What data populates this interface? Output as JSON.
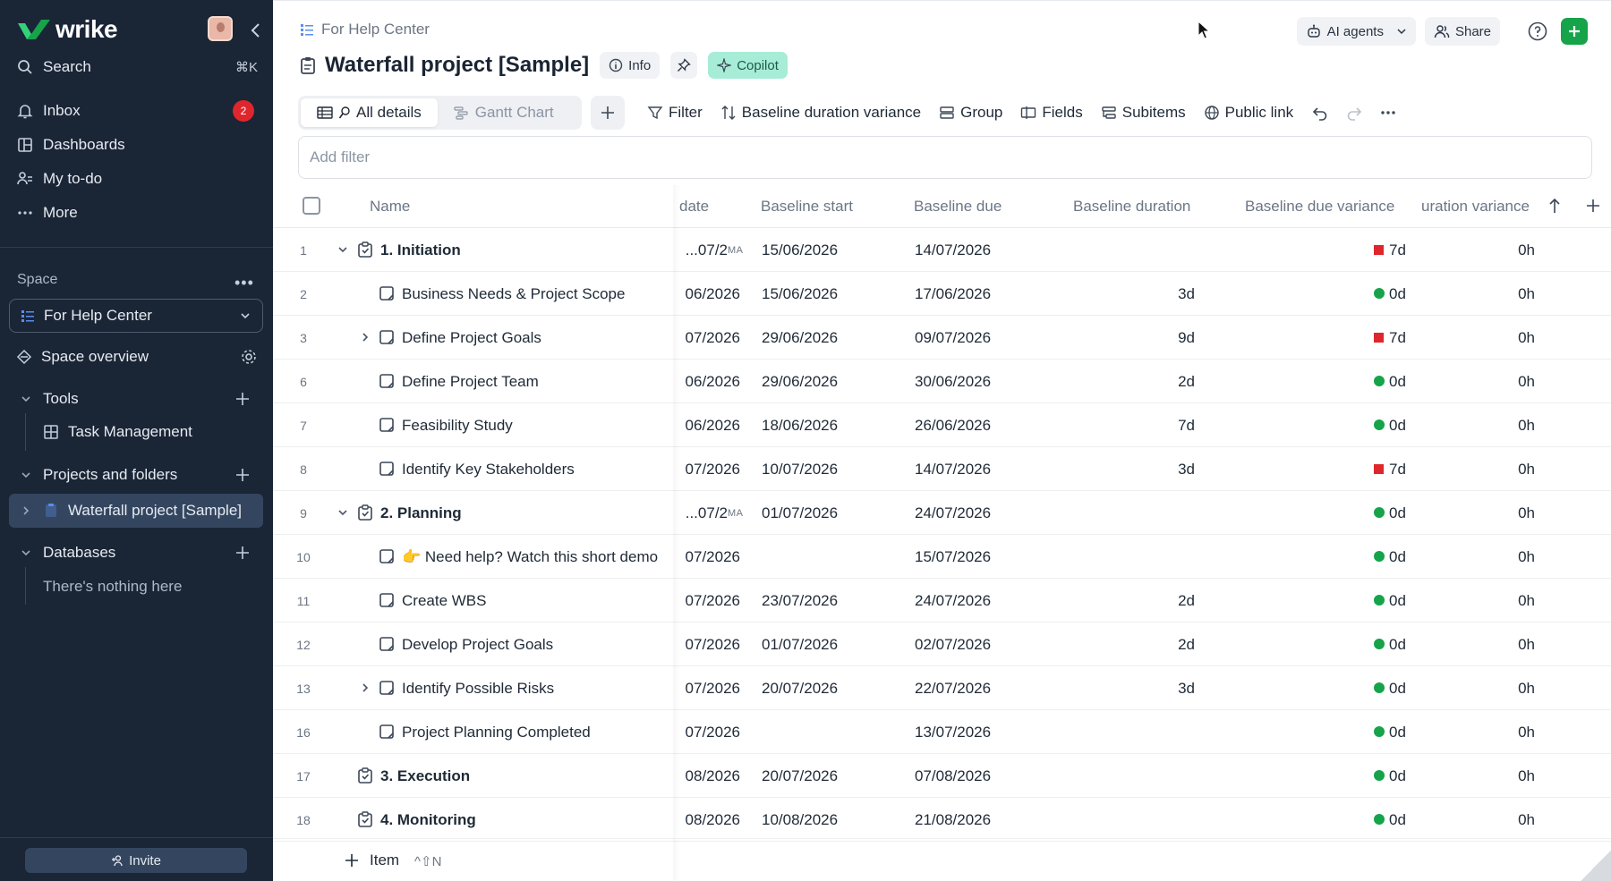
{
  "sidebar": {
    "brand": "wrike",
    "nav": [
      {
        "label": "Search",
        "icon": "search-icon",
        "shortcut": "⌘K"
      },
      {
        "label": "Inbox",
        "icon": "bell-icon",
        "badge": "2"
      },
      {
        "label": "Dashboards",
        "icon": "dashboard-icon"
      },
      {
        "label": "My to-do",
        "icon": "person-list-icon"
      },
      {
        "label": "More",
        "icon": "ellipsis-icon"
      }
    ],
    "space_label": "Space",
    "space_selected": "For Help Center",
    "space_overview": "Space overview",
    "tools_label": "Tools",
    "tools_item": "Task Management",
    "projects_label": "Projects and folders",
    "project_item": "Waterfall project [Sample]",
    "databases_label": "Databases",
    "databases_empty": "There's nothing here",
    "invite": "Invite"
  },
  "header": {
    "breadcrumb": "For Help Center",
    "title": "Waterfall project [Sample]",
    "info": "Info",
    "copilot": "Copilot",
    "ai_agents": "AI agents",
    "share": "Share"
  },
  "views": {
    "tabs": [
      "All details",
      "Gantt Chart"
    ],
    "active": "All details"
  },
  "toolbar": {
    "filter": "Filter",
    "sort": "Baseline duration variance",
    "group": "Group",
    "fields": "Fields",
    "subitems": "Subitems",
    "public_link": "Public link"
  },
  "filter_placeholder": "Add filter",
  "columns": {
    "name": "Name",
    "date": "date",
    "baseline_start": "Baseline start",
    "baseline_due": "Baseline due",
    "baseline_duration": "Baseline duration",
    "baseline_due_variance": "Baseline due variance",
    "duration_variance": "uration variance"
  },
  "rows": [
    {
      "num": "1",
      "name": "1. Initiation",
      "level": 0,
      "type": "project",
      "expander": "down",
      "date": "07/2...",
      "ma": "MA",
      "bstart": "15/06/2026",
      "bdue": "14/07/2026",
      "bdur": "",
      "status": "red",
      "dvar": "7d",
      "durvar": "0h"
    },
    {
      "num": "2",
      "name": "Business Needs & Project Scope",
      "level": 1,
      "type": "task",
      "expander": "",
      "date": "06/2026",
      "bstart": "15/06/2026",
      "bdue": "17/06/2026",
      "bdur": "3d",
      "status": "green",
      "dvar": "0d",
      "durvar": "0h"
    },
    {
      "num": "3",
      "name": "Define Project Goals",
      "level": 1,
      "type": "task",
      "expander": "right",
      "date": "07/2026",
      "bstart": "29/06/2026",
      "bdue": "09/07/2026",
      "bdur": "9d",
      "status": "red",
      "dvar": "7d",
      "durvar": "0h"
    },
    {
      "num": "6",
      "name": "Define Project Team",
      "level": 1,
      "type": "task",
      "expander": "",
      "date": "06/2026",
      "bstart": "29/06/2026",
      "bdue": "30/06/2026",
      "bdur": "2d",
      "status": "green",
      "dvar": "0d",
      "durvar": "0h"
    },
    {
      "num": "7",
      "name": "Feasibility Study",
      "level": 1,
      "type": "task",
      "expander": "",
      "date": "06/2026",
      "bstart": "18/06/2026",
      "bdue": "26/06/2026",
      "bdur": "7d",
      "status": "green",
      "dvar": "0d",
      "durvar": "0h"
    },
    {
      "num": "8",
      "name": "Identify Key Stakeholders",
      "level": 1,
      "type": "task",
      "expander": "",
      "date": "07/2026",
      "bstart": "10/07/2026",
      "bdue": "14/07/2026",
      "bdur": "3d",
      "status": "red",
      "dvar": "7d",
      "durvar": "0h"
    },
    {
      "num": "9",
      "name": "2. Planning",
      "level": 0,
      "type": "project",
      "expander": "down",
      "date": "07/2...",
      "ma": "MA",
      "bstart": "01/07/2026",
      "bdue": "24/07/2026",
      "bdur": "",
      "status": "green",
      "dvar": "0d",
      "durvar": "0h"
    },
    {
      "num": "10",
      "name": "👉 Need help? Watch this short demo",
      "level": 1,
      "type": "task",
      "expander": "",
      "date": "07/2026",
      "bstart": "",
      "bdue": "15/07/2026",
      "bdur": "",
      "status": "green",
      "dvar": "0d",
      "durvar": "0h"
    },
    {
      "num": "11",
      "name": "Create WBS",
      "level": 1,
      "type": "task",
      "expander": "",
      "date": "07/2026",
      "bstart": "23/07/2026",
      "bdue": "24/07/2026",
      "bdur": "2d",
      "status": "green",
      "dvar": "0d",
      "durvar": "0h"
    },
    {
      "num": "12",
      "name": "Develop Project Goals",
      "level": 1,
      "type": "task",
      "expander": "",
      "date": "07/2026",
      "bstart": "01/07/2026",
      "bdue": "02/07/2026",
      "bdur": "2d",
      "status": "green",
      "dvar": "0d",
      "durvar": "0h"
    },
    {
      "num": "13",
      "name": "Identify Possible Risks",
      "level": 1,
      "type": "task",
      "expander": "right",
      "date": "07/2026",
      "bstart": "20/07/2026",
      "bdue": "22/07/2026",
      "bdur": "3d",
      "status": "green",
      "dvar": "0d",
      "durvar": "0h"
    },
    {
      "num": "16",
      "name": "Project Planning Completed",
      "level": 1,
      "type": "task",
      "expander": "",
      "date": "07/2026",
      "bstart": "",
      "bdue": "13/07/2026",
      "bdur": "",
      "status": "green",
      "dvar": "0d",
      "durvar": "0h"
    },
    {
      "num": "17",
      "name": "3. Execution",
      "level": 0,
      "type": "project",
      "expander": "",
      "date": "08/2026",
      "bstart": "20/07/2026",
      "bdue": "07/08/2026",
      "bdur": "",
      "status": "green",
      "dvar": "0d",
      "durvar": "0h"
    },
    {
      "num": "18",
      "name": "4. Monitoring",
      "level": 0,
      "type": "project",
      "expander": "",
      "date": "08/2026",
      "bstart": "10/08/2026",
      "bdue": "21/08/2026",
      "bdur": "",
      "status": "green",
      "dvar": "0d",
      "durvar": "0h"
    }
  ],
  "add_item": {
    "label": "Item",
    "shortcut": "^⇧N"
  },
  "colors": {
    "sidebar_bg": "#1a2536",
    "accent_green": "#16a34a",
    "status_red": "#e0262d",
    "copilot_bg": "#a6ecd6"
  }
}
